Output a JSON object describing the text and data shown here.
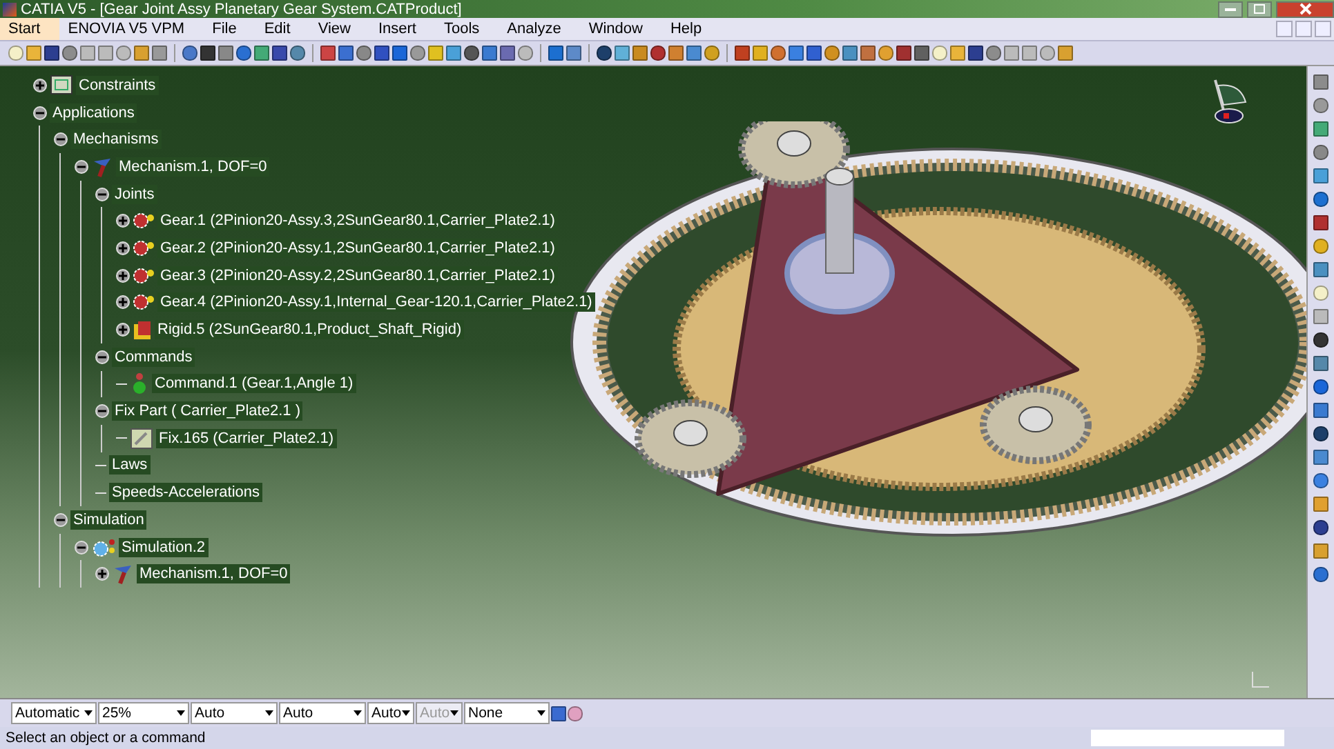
{
  "window": {
    "title": "CATIA V5 - [Gear Joint Assy Planetary Gear System.CATProduct]"
  },
  "menu": [
    {
      "label": "Start",
      "selected": true
    },
    {
      "label": "ENOVIA V5 VPM",
      "selected": false
    },
    {
      "label": "File",
      "selected": false
    },
    {
      "label": "Edit",
      "selected": false
    },
    {
      "label": "View",
      "selected": false
    },
    {
      "label": "Insert",
      "selected": false
    },
    {
      "label": "Tools",
      "selected": false
    },
    {
      "label": "Analyze",
      "selected": false
    },
    {
      "label": "Window",
      "selected": false
    },
    {
      "label": "Help",
      "selected": false
    }
  ],
  "tree": [
    {
      "label": "Constraints",
      "kind": "constraints",
      "expanded": false
    },
    {
      "label": "Applications",
      "expanded": true,
      "children": [
        {
          "label": "Mechanisms",
          "expanded": true,
          "children": [
            {
              "label": "Mechanism.1, DOF=0",
              "kind": "mechanism",
              "expanded": true,
              "children": [
                {
                  "label": "Joints",
                  "expanded": true,
                  "children": [
                    {
                      "label": "Gear.1 (2Pinion20-Assy.3,2SunGear80.1,Carrier_Plate2.1)",
                      "kind": "gear",
                      "expanded": false
                    },
                    {
                      "label": "Gear.2 (2Pinion20-Assy.1,2SunGear80.1,Carrier_Plate2.1)",
                      "kind": "gear",
                      "expanded": false
                    },
                    {
                      "label": "Gear.3 (2Pinion20-Assy.2,2SunGear80.1,Carrier_Plate2.1)",
                      "kind": "gear",
                      "expanded": false
                    },
                    {
                      "label": "Gear.4 (2Pinion20-Assy.1,Internal_Gear-120.1,Carrier_Plate2.1)",
                      "kind": "gear",
                      "expanded": false
                    },
                    {
                      "label": "Rigid.5 (2SunGear80.1,Product_Shaft_Rigid)",
                      "kind": "rigid",
                      "expanded": false
                    }
                  ]
                },
                {
                  "label": "Commands",
                  "expanded": true,
                  "children": [
                    {
                      "label": "Command.1 (Gear.1,Angle 1)",
                      "kind": "command"
                    }
                  ]
                },
                {
                  "label": "Fix Part ( Carrier_Plate2.1 )",
                  "expanded": true,
                  "children": [
                    {
                      "label": "Fix.165 (Carrier_Plate2.1)",
                      "kind": "fix"
                    }
                  ]
                },
                {
                  "label": "Laws"
                },
                {
                  "label": "Speeds-Accelerations"
                }
              ]
            }
          ]
        },
        {
          "label": "Simulation",
          "expanded": true,
          "children": [
            {
              "label": "Simulation.2",
              "kind": "simulation",
              "expanded": true,
              "children": [
                {
                  "label": "Mechanism.1, DOF=0",
                  "kind": "mechanism",
                  "expanded": false
                }
              ]
            }
          ]
        }
      ]
    }
  ],
  "bottom_toolbar": [
    {
      "value": "Automatic",
      "disabled": false
    },
    {
      "value": "25%",
      "disabled": false
    },
    {
      "value": "Auto",
      "disabled": false
    },
    {
      "value": "Auto",
      "disabled": false
    },
    {
      "value": "Auto",
      "disabled": false
    },
    {
      "value": "Auto",
      "disabled": true
    },
    {
      "value": "None",
      "disabled": false
    }
  ],
  "status_bar": {
    "message": "Select an object or a command"
  }
}
